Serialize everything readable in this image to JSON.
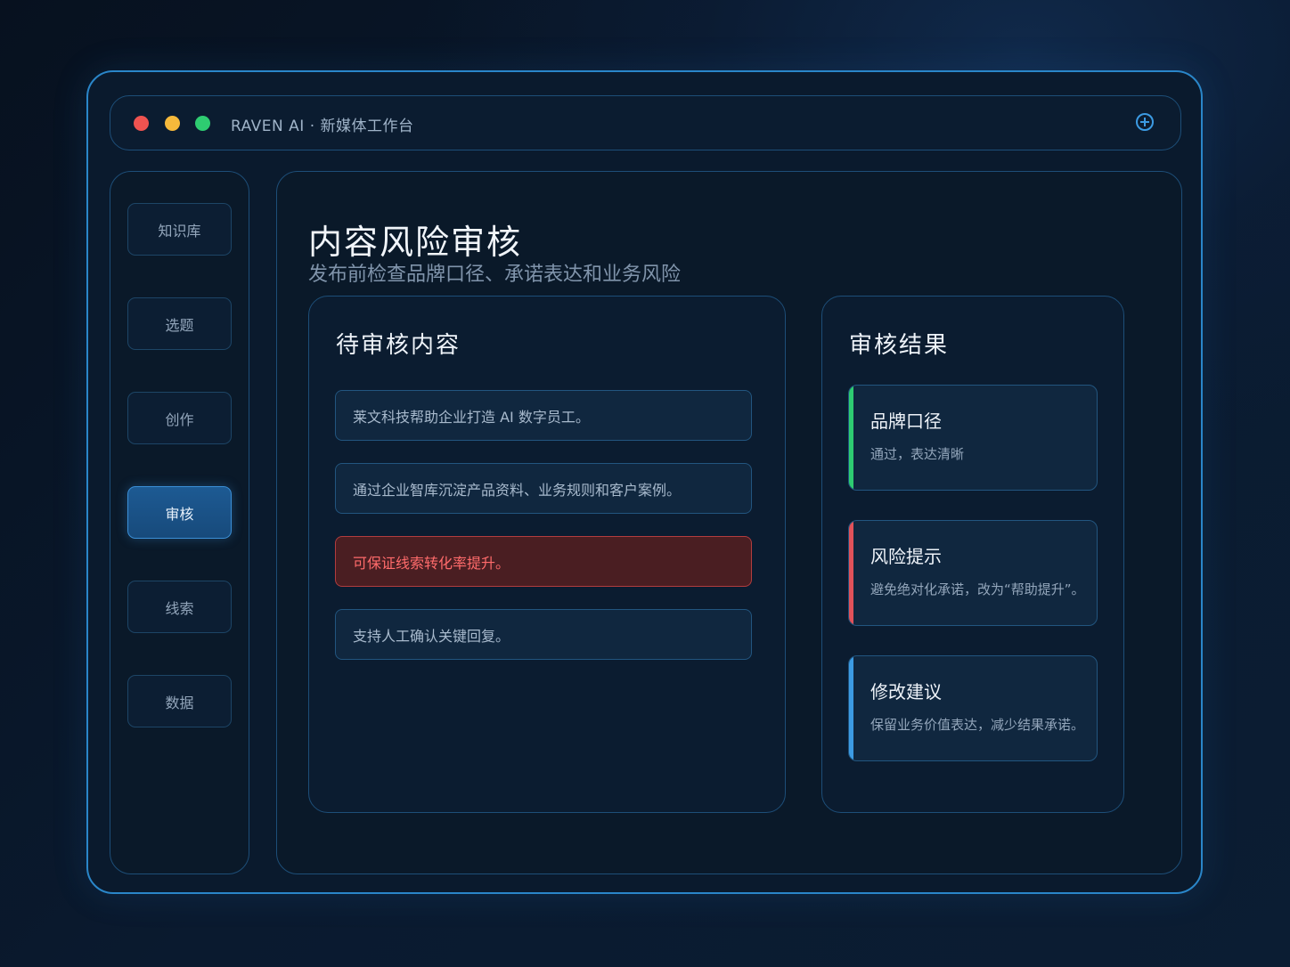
{
  "window": {
    "title": "RAVEN AI · 新媒体工作台",
    "traffic_lights": {
      "red": "#ef5350",
      "yellow": "#f6b93b",
      "green": "#2ecc71"
    },
    "plus_icon": "plus-circle-icon"
  },
  "sidebar": {
    "items": [
      {
        "label": "知识库",
        "active": false
      },
      {
        "label": "选题",
        "active": false
      },
      {
        "label": "创作",
        "active": false
      },
      {
        "label": "审核",
        "active": true
      },
      {
        "label": "线索",
        "active": false
      },
      {
        "label": "数据",
        "active": false
      }
    ]
  },
  "main": {
    "title": "内容风险审核",
    "subtitle": "发布前检查品牌口径、承诺表达和业务风险",
    "pending": {
      "title": "待审核内容",
      "items": [
        {
          "text": "莱文科技帮助企业打造 AI 数字员工。",
          "risk": false
        },
        {
          "text": "通过企业智库沉淀产品资料、业务规则和客户案例。",
          "risk": false
        },
        {
          "text": "可保证线索转化率提升。",
          "risk": true
        },
        {
          "text": "支持人工确认关键回复。",
          "risk": false
        }
      ]
    },
    "results": {
      "title": "审核结果",
      "cards": [
        {
          "title": "品牌口径",
          "desc": "通过，表达清晰",
          "color": "#2ecc71"
        },
        {
          "title": "风险提示",
          "desc": "避免绝对化承诺，改为“帮助提升”。",
          "color": "#e0525a"
        },
        {
          "title": "修改建议",
          "desc": "保留业务价值表达，减少结果承诺。",
          "color": "#3c9be3"
        }
      ]
    }
  },
  "colors": {
    "accent": "#2a86c9",
    "risk": "#ff6b6b",
    "pass": "#2ecc71"
  }
}
